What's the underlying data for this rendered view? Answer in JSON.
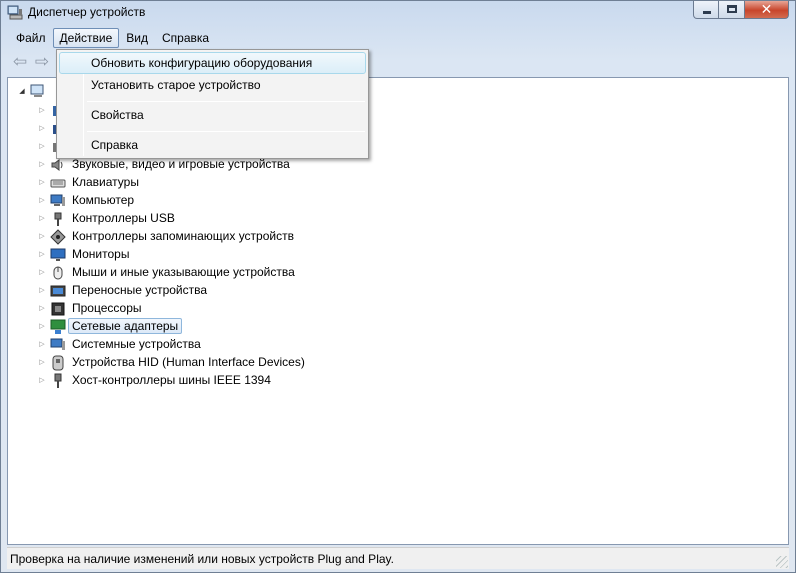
{
  "window": {
    "title": "Диспетчер устройств"
  },
  "menubar": {
    "items": [
      {
        "label": "Файл"
      },
      {
        "label": "Действие"
      },
      {
        "label": "Вид"
      },
      {
        "label": "Справка"
      }
    ]
  },
  "toolbar": {
    "back_icon": "arrow-left-icon",
    "forward_icon": "arrow-right-icon"
  },
  "action_menu": {
    "items": [
      {
        "label": "Обновить конфигурацию оборудования"
      },
      {
        "label": "Установить старое устройство"
      },
      {
        "label": "Свойства"
      },
      {
        "label": "Справка"
      }
    ]
  },
  "tree": {
    "items": [
      {
        "label": "Звуковые, видео и игровые устройства"
      },
      {
        "label": "Клавиатуры"
      },
      {
        "label": "Компьютер"
      },
      {
        "label": "Контроллеры USB"
      },
      {
        "label": "Контроллеры запоминающих устройств"
      },
      {
        "label": "Мониторы"
      },
      {
        "label": "Мыши и иные указывающие устройства"
      },
      {
        "label": "Переносные устройства"
      },
      {
        "label": "Процессоры"
      },
      {
        "label": "Сетевые адаптеры"
      },
      {
        "label": "Системные устройства"
      },
      {
        "label": "Устройства HID (Human Interface Devices)"
      },
      {
        "label": "Хост-контроллеры шины IEEE 1394"
      }
    ]
  },
  "statusbar": {
    "text": "Проверка на наличие изменений или новых устройств Plug and Play."
  }
}
